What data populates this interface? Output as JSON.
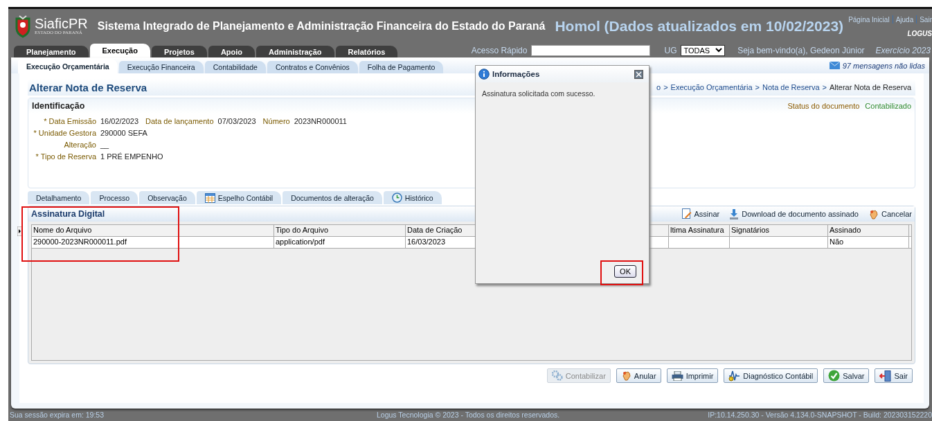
{
  "header": {
    "logo_name": "SiaficPR",
    "logo_sub": "ESTADO DO PARANÁ",
    "title": "Sistema Integrado de Planejamento e Administração Financeira do Estado do Paraná",
    "environment": "Homol (Dados atualizados em 10/02/2023)",
    "links": [
      "Página Inicial",
      "Ajuda",
      "Sair"
    ],
    "brand": "LOGUS"
  },
  "main_tabs": [
    {
      "label": "Planejamento",
      "selected": false
    },
    {
      "label": "Execução",
      "selected": true
    },
    {
      "label": "Projetos",
      "selected": false
    },
    {
      "label": "Apoio",
      "selected": false
    },
    {
      "label": "Administração",
      "selected": false
    },
    {
      "label": "Relatórios",
      "selected": false
    }
  ],
  "quick_access": {
    "label": "Acesso Rápido"
  },
  "ug": {
    "label": "UG",
    "value": "TODAS"
  },
  "welcome": "Seja bem-vindo(a), Gedeon Júnior",
  "exercise": "Exercício 2023",
  "sub_tabs": [
    {
      "label": "Execução Orçamentária",
      "selected": true
    },
    {
      "label": "Execução Financeira",
      "selected": false
    },
    {
      "label": "Contabilidade",
      "selected": false
    },
    {
      "label": "Contratos e Convênios",
      "selected": false
    },
    {
      "label": "Folha de Pagamento",
      "selected": false
    }
  ],
  "messages": "97 mensagens não lidas",
  "page_title": "Alterar Nota de Reserva",
  "breadcrumb_separator": ">",
  "breadcrumb": [
    "o",
    "Execução Orçamentária",
    "Nota de Reserva",
    "Alterar Nota de Reserva"
  ],
  "identification": {
    "title": "Identificação",
    "status_label": "Status do documento",
    "status_value": "Contabilizado",
    "rows": [
      [
        {
          "label": "* Data Emissão",
          "value": "16/02/2023"
        },
        {
          "label": "Data de lançamento",
          "value": "07/03/2023"
        },
        {
          "label": "Número",
          "value": "2023NR000011"
        }
      ],
      [
        {
          "label": "* Unidade Gestora",
          "value": "290000  SEFA"
        }
      ],
      [
        {
          "label": "Alteração",
          "value": "__"
        }
      ],
      [
        {
          "label": "* Tipo de Reserva",
          "value": "1  PRÉ EMPENHO"
        }
      ]
    ]
  },
  "detail_tabs": [
    {
      "label": "Detalhamento",
      "kind": "plain",
      "selected": false
    },
    {
      "label": "Processo",
      "kind": "plain",
      "selected": false
    },
    {
      "label": "Observação",
      "kind": "plain",
      "selected": false
    },
    {
      "label": "Espelho Contábil",
      "kind": "grid",
      "selected": false
    },
    {
      "label": "Documentos de alteração",
      "kind": "plain",
      "selected": false
    },
    {
      "label": "Histórico",
      "kind": "clock",
      "selected": false
    }
  ],
  "signature": {
    "title": "Assinatura Digital",
    "highlighted": true,
    "actions": [
      {
        "label": "Assinar",
        "kind": "sign"
      },
      {
        "label": "Download de documento assinado",
        "kind": "download"
      },
      {
        "label": "Cancelar",
        "kind": "cancel"
      }
    ],
    "columns": [
      "Nome do Arquivo",
      "Tipo do Arquivo",
      "Data de Criação",
      "ltima Assinatura",
      "Signatários",
      "Assinado"
    ],
    "rows": [
      [
        "290000-2023NR000011.pdf",
        "application/pdf",
        "16/03/2023",
        null,
        null,
        "Não"
      ]
    ]
  },
  "buttons": [
    {
      "label": "Contabilizar",
      "kind": "gears",
      "disabled": true
    },
    {
      "label": "Anular",
      "kind": "cancel",
      "disabled": false
    },
    {
      "label": "Imprimir",
      "kind": "printer",
      "disabled": false
    },
    {
      "label": "Diagnóstico Contábil",
      "kind": "diagnostic",
      "disabled": false
    },
    {
      "label": "Salvar",
      "kind": "check",
      "disabled": false
    },
    {
      "label": "Sair",
      "kind": "exit",
      "disabled": false
    }
  ],
  "dialog": {
    "title": "Informações",
    "message": "Assinatura solicitada com sucesso.",
    "button": "OK",
    "highlighted": true
  },
  "footer": {
    "session": "Sua sessão expira em: 19:53",
    "copyright": "Logus Tecnologia © 2023 - Todos os direitos reservados.",
    "build": "IP:10.14.250.30 - Versão 4.134.0-SNAPSHOT - Build: 202303152220"
  }
}
